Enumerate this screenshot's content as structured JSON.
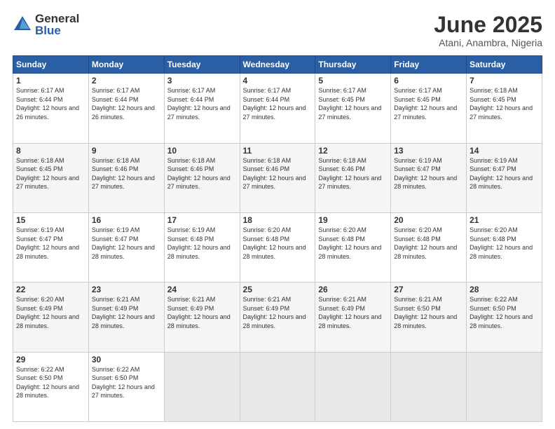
{
  "logo": {
    "general": "General",
    "blue": "Blue"
  },
  "title": "June 2025",
  "subtitle": "Atani, Anambra, Nigeria",
  "headers": [
    "Sunday",
    "Monday",
    "Tuesday",
    "Wednesday",
    "Thursday",
    "Friday",
    "Saturday"
  ],
  "weeks": [
    [
      {
        "day": "1",
        "sunrise": "6:17 AM",
        "sunset": "6:44 PM",
        "daylight": "12 hours and 26 minutes."
      },
      {
        "day": "2",
        "sunrise": "6:17 AM",
        "sunset": "6:44 PM",
        "daylight": "12 hours and 26 minutes."
      },
      {
        "day": "3",
        "sunrise": "6:17 AM",
        "sunset": "6:44 PM",
        "daylight": "12 hours and 27 minutes."
      },
      {
        "day": "4",
        "sunrise": "6:17 AM",
        "sunset": "6:44 PM",
        "daylight": "12 hours and 27 minutes."
      },
      {
        "day": "5",
        "sunrise": "6:17 AM",
        "sunset": "6:45 PM",
        "daylight": "12 hours and 27 minutes."
      },
      {
        "day": "6",
        "sunrise": "6:17 AM",
        "sunset": "6:45 PM",
        "daylight": "12 hours and 27 minutes."
      },
      {
        "day": "7",
        "sunrise": "6:18 AM",
        "sunset": "6:45 PM",
        "daylight": "12 hours and 27 minutes."
      }
    ],
    [
      {
        "day": "8",
        "sunrise": "6:18 AM",
        "sunset": "6:45 PM",
        "daylight": "12 hours and 27 minutes."
      },
      {
        "day": "9",
        "sunrise": "6:18 AM",
        "sunset": "6:46 PM",
        "daylight": "12 hours and 27 minutes."
      },
      {
        "day": "10",
        "sunrise": "6:18 AM",
        "sunset": "6:46 PM",
        "daylight": "12 hours and 27 minutes."
      },
      {
        "day": "11",
        "sunrise": "6:18 AM",
        "sunset": "6:46 PM",
        "daylight": "12 hours and 27 minutes."
      },
      {
        "day": "12",
        "sunrise": "6:18 AM",
        "sunset": "6:46 PM",
        "daylight": "12 hours and 27 minutes."
      },
      {
        "day": "13",
        "sunrise": "6:19 AM",
        "sunset": "6:47 PM",
        "daylight": "12 hours and 28 minutes."
      },
      {
        "day": "14",
        "sunrise": "6:19 AM",
        "sunset": "6:47 PM",
        "daylight": "12 hours and 28 minutes."
      }
    ],
    [
      {
        "day": "15",
        "sunrise": "6:19 AM",
        "sunset": "6:47 PM",
        "daylight": "12 hours and 28 minutes."
      },
      {
        "day": "16",
        "sunrise": "6:19 AM",
        "sunset": "6:47 PM",
        "daylight": "12 hours and 28 minutes."
      },
      {
        "day": "17",
        "sunrise": "6:19 AM",
        "sunset": "6:48 PM",
        "daylight": "12 hours and 28 minutes."
      },
      {
        "day": "18",
        "sunrise": "6:20 AM",
        "sunset": "6:48 PM",
        "daylight": "12 hours and 28 minutes."
      },
      {
        "day": "19",
        "sunrise": "6:20 AM",
        "sunset": "6:48 PM",
        "daylight": "12 hours and 28 minutes."
      },
      {
        "day": "20",
        "sunrise": "6:20 AM",
        "sunset": "6:48 PM",
        "daylight": "12 hours and 28 minutes."
      },
      {
        "day": "21",
        "sunrise": "6:20 AM",
        "sunset": "6:48 PM",
        "daylight": "12 hours and 28 minutes."
      }
    ],
    [
      {
        "day": "22",
        "sunrise": "6:20 AM",
        "sunset": "6:49 PM",
        "daylight": "12 hours and 28 minutes."
      },
      {
        "day": "23",
        "sunrise": "6:21 AM",
        "sunset": "6:49 PM",
        "daylight": "12 hours and 28 minutes."
      },
      {
        "day": "24",
        "sunrise": "6:21 AM",
        "sunset": "6:49 PM",
        "daylight": "12 hours and 28 minutes."
      },
      {
        "day": "25",
        "sunrise": "6:21 AM",
        "sunset": "6:49 PM",
        "daylight": "12 hours and 28 minutes."
      },
      {
        "day": "26",
        "sunrise": "6:21 AM",
        "sunset": "6:49 PM",
        "daylight": "12 hours and 28 minutes."
      },
      {
        "day": "27",
        "sunrise": "6:21 AM",
        "sunset": "6:50 PM",
        "daylight": "12 hours and 28 minutes."
      },
      {
        "day": "28",
        "sunrise": "6:22 AM",
        "sunset": "6:50 PM",
        "daylight": "12 hours and 28 minutes."
      }
    ],
    [
      {
        "day": "29",
        "sunrise": "6:22 AM",
        "sunset": "6:50 PM",
        "daylight": "12 hours and 28 minutes."
      },
      {
        "day": "30",
        "sunrise": "6:22 AM",
        "sunset": "6:50 PM",
        "daylight": "12 hours and 27 minutes."
      },
      null,
      null,
      null,
      null,
      null
    ]
  ]
}
